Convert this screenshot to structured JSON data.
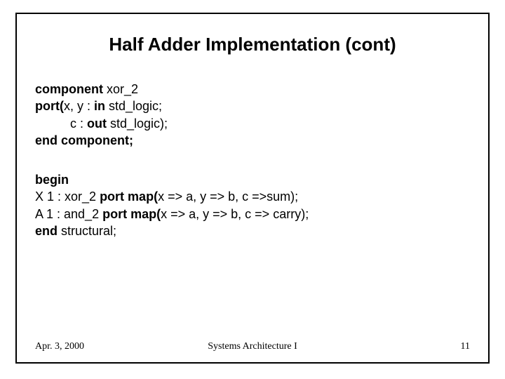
{
  "title": "Half Adder Implementation (cont)",
  "code": {
    "l1a": "component",
    "l1b": " xor_2",
    "l2a": "port(",
    "l2b": "x, y : ",
    "l2c": "in",
    "l2d": " std_logic;",
    "l3a": "c : ",
    "l3b": "out",
    "l3c": " std_logic);",
    "l4": "end component;",
    "l5": "begin",
    "l6a": "X 1 : xor_2 ",
    "l6b": "port map(",
    "l6c": "x => a, y => b, c =>sum);",
    "l7a": "A 1 : and_2 ",
    "l7b": "port map(",
    "l7c": "x => a, y => b, c => carry);",
    "l8a": "end",
    "l8b": " structural;"
  },
  "footer": {
    "date": "Apr. 3, 2000",
    "course": "Systems Architecture I",
    "page": "11"
  }
}
